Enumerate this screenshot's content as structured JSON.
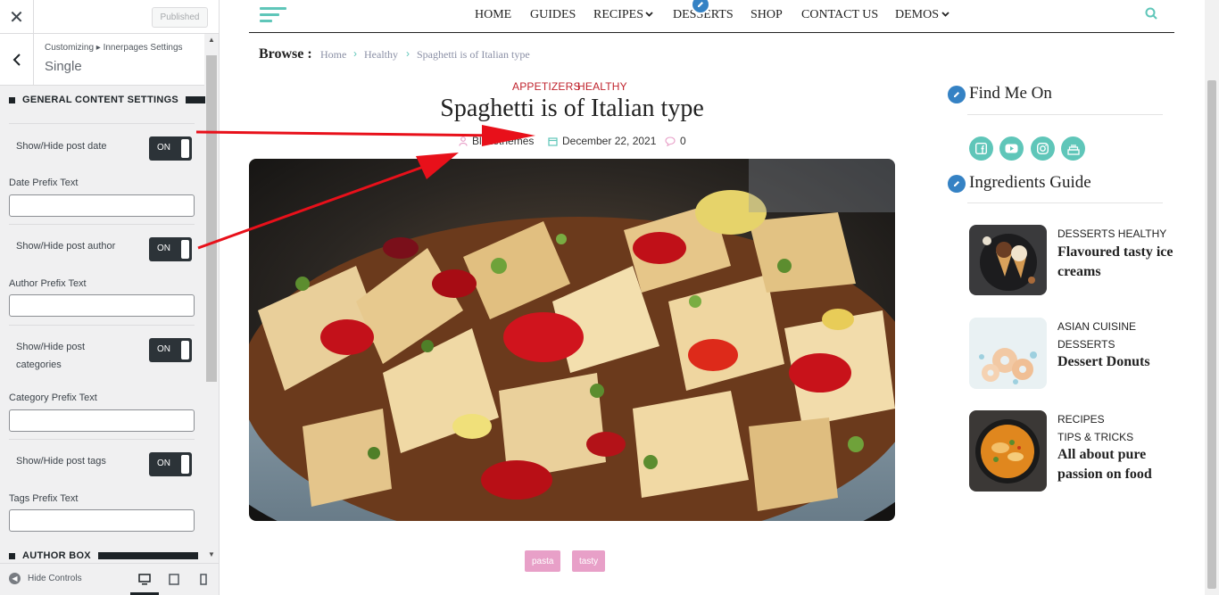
{
  "customizer": {
    "close_label": "✕",
    "published_label": "Published",
    "breadcrumb": "Customizing ▸ Innerpages Settings",
    "title": "Single",
    "section_general": "GENERAL CONTENT SETTINGS",
    "toggles": [
      {
        "label": "Show/Hide post date",
        "state": "ON"
      },
      {
        "label": "Show/Hide post author",
        "state": "ON"
      },
      {
        "label": "Show/Hide post categories",
        "state": "ON"
      },
      {
        "label": "Show/Hide post tags",
        "state": "ON"
      }
    ],
    "fields": [
      {
        "label": "Date Prefix Text",
        "value": ""
      },
      {
        "label": "Author Prefix Text",
        "value": ""
      },
      {
        "label": "Category Prefix Text",
        "value": ""
      },
      {
        "label": "Tags Prefix Text",
        "value": ""
      }
    ],
    "section_author": "AUTHOR BOX",
    "hide_controls": "Hide Controls"
  },
  "nav": {
    "items": [
      "HOME",
      "GUIDES",
      "RECIPES",
      "DESSERTS",
      "SHOP",
      "CONTACT US",
      "DEMOS"
    ]
  },
  "breadcrumb": {
    "browse": "Browse :",
    "home": "Home",
    "healthy": "Healthy",
    "current": "Spaghetti is of Italian type"
  },
  "post": {
    "categories": [
      "APPETIZERS",
      "HEALTHY"
    ],
    "title": "Spaghetti is of Italian type",
    "author": "Blazethemes",
    "date": "December 22, 2021",
    "comments": "0",
    "tags": [
      "pasta",
      "tasty"
    ]
  },
  "sidebar": {
    "find_me_title": "Find Me On",
    "social_icons": [
      "facebook-icon",
      "youtube-icon",
      "instagram-icon",
      "cake-icon"
    ],
    "ingredients_title": "Ingredients Guide",
    "items": [
      {
        "cat1": "DESSERTS  HEALTHY",
        "cat2": "",
        "title": "Flavoured tasty ice creams"
      },
      {
        "cat1": "ASIAN CUISINE",
        "cat2": "DESSERTS",
        "title": "Dessert Donuts"
      },
      {
        "cat1": "RECIPES",
        "cat2": "TIPS & TRICKS",
        "title": "All about pure passion on food"
      }
    ]
  },
  "colors": {
    "accent": "#5fc6b9",
    "category": "#c0232d",
    "tag_bg": "#e8a0c8",
    "toggle_bg": "#2c3338",
    "edit_pin": "#3582c4",
    "annotation_arrow": "#e8101a"
  }
}
